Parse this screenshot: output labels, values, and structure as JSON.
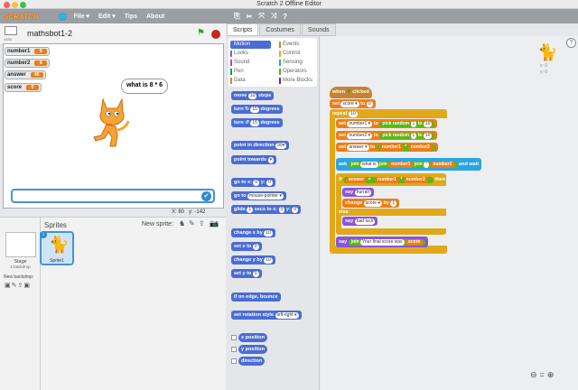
{
  "window": {
    "title": "Scratch 2 Offline Editor"
  },
  "menubar": {
    "logo": "SCRATCH",
    "file": "File",
    "edit": "Edit",
    "tips": "Tips",
    "about": "About"
  },
  "project": {
    "version": "v426",
    "title": "mathsbot1-2"
  },
  "monitors": [
    {
      "label": "number1",
      "value": "8"
    },
    {
      "label": "number2",
      "value": "6"
    },
    {
      "label": "answer",
      "value": "48"
    },
    {
      "label": "score",
      "value": "0"
    }
  ],
  "stage": {
    "bubble": "what is 8 * 6",
    "coords_x": "X: 80",
    "coords_y": "y: -142"
  },
  "sprites": {
    "header": "Sprites",
    "new_sprite": "New sprite:",
    "stage_label": "Stage",
    "stage_sub": "1 backdrop",
    "new_backdrop": "New backdrop:",
    "sprite1": "Sprite1"
  },
  "tabs": [
    "Scripts",
    "Costumes",
    "Sounds"
  ],
  "categories": {
    "left": [
      "Motion",
      "Looks",
      "Sound",
      "Pen",
      "Data"
    ],
    "right": [
      "Events",
      "Control",
      "Sensing",
      "Operators",
      "More Blocks"
    ]
  },
  "category_colors": {
    "Motion": "#4a6cd4",
    "Looks": "#8a55d7",
    "Sound": "#bb42c3",
    "Pen": "#0e9a6c",
    "Data": "#ee7d16",
    "Events": "#c88330",
    "Control": "#e1a91a",
    "Sensing": "#2ca5e2",
    "Operators": "#5cb712",
    "More Blocks": "#632d99"
  },
  "palette": {
    "move": [
      "move",
      "10",
      "steps"
    ],
    "turn_r": [
      "turn",
      "15",
      "degrees"
    ],
    "turn_l": [
      "turn",
      "15",
      "degrees"
    ],
    "point_dir": [
      "point in direction",
      "90▾"
    ],
    "point_towards": [
      "point towards",
      "▾"
    ],
    "goto_xy": [
      "go to x:",
      "0",
      "y:",
      "0"
    ],
    "goto": [
      "go to",
      "mouse-pointer ▾"
    ],
    "glide": [
      "glide",
      "1",
      "secs to x:",
      "0",
      "y:",
      "0"
    ],
    "change_x": [
      "change x by",
      "10"
    ],
    "set_x": [
      "set x to",
      "0"
    ],
    "change_y": [
      "change y by",
      "10"
    ],
    "set_y": [
      "set y to",
      "0"
    ],
    "bounce": "if on edge, bounce",
    "rotation": [
      "set rotation style",
      "left-right ▾"
    ],
    "reporters": [
      "x position",
      "y position",
      "direction"
    ]
  },
  "script": {
    "hat": [
      "when",
      "clicked"
    ],
    "set_score": [
      "set",
      "score ▾",
      "to",
      "0"
    ],
    "repeat": [
      "repeat",
      "10"
    ],
    "set_n1": [
      "set",
      "number1 ▾",
      "to",
      "pick random",
      "1",
      "to",
      "10"
    ],
    "set_n2": [
      "set",
      "number2 ▾",
      "to",
      "pick random",
      "1",
      "to",
      "10"
    ],
    "set_ans": [
      "set",
      "answer ▾",
      "to",
      "number1",
      "*",
      "number2"
    ],
    "ask": [
      "ask",
      "join",
      "what is",
      "join",
      "number1",
      "join",
      "*",
      "number2",
      "and wait"
    ],
    "if": [
      "if",
      "answer",
      "=",
      "number1",
      "*",
      "number2",
      "then"
    ],
    "say_hurrah": [
      "say",
      "hurrah"
    ],
    "change_score": [
      "change",
      "score ▾",
      "by",
      "1"
    ],
    "else": "else",
    "say_bad": [
      "say",
      "bad luck"
    ],
    "say_final": [
      "say",
      "join",
      "Your final score was",
      "score"
    ]
  },
  "sprite_info": {
    "x": "x: 0",
    "y": "y: 0"
  }
}
